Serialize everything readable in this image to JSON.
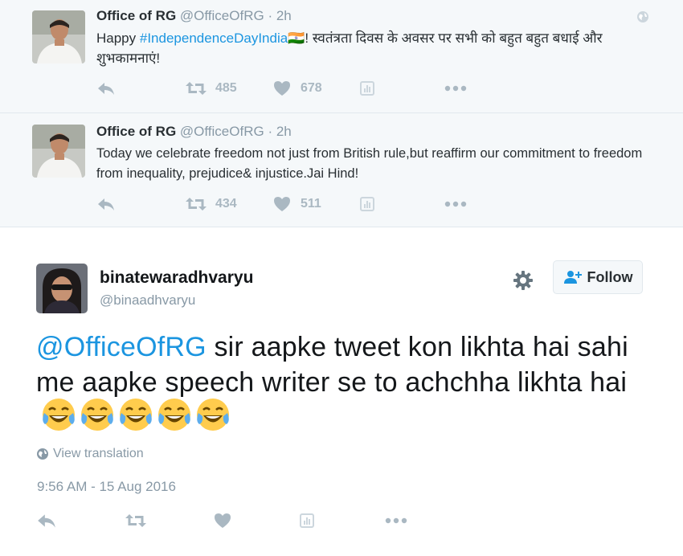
{
  "tweets": [
    {
      "name": "Office of RG",
      "handle": "@OfficeOfRG",
      "time": "· 2h",
      "text_prefix": "Happy ",
      "hashtag": "#IndependenceDayIndia",
      "flag_emoji": "🇮🇳",
      "text_suffix": "! स्वतंत्रता दिवस के अवसर पर सभी को बहुत बहुत बधाई और शुभकामनाएं!",
      "retweets": "485",
      "likes": "678"
    },
    {
      "name": "Office of RG",
      "handle": "@OfficeOfRG",
      "time": "· 2h",
      "text": "Today we celebrate freedom not just from British rule,but reaffirm our commitment to freedom from inequality, prejudice& injustice.Jai Hind!",
      "retweets": "434",
      "likes": "511"
    }
  ],
  "main_tweet": {
    "name": "binatewaradhvaryu",
    "handle": "@binaadhvaryu",
    "follow_label": "Follow",
    "mention": "@OfficeOfRG",
    "text": " sir aapke tweet kon likhta hai sahi me aapke speech writer se to achchha likhta hai",
    "emoji_count": 5,
    "view_translation": "View translation",
    "timestamp": "9:56 AM - 15 Aug 2016"
  },
  "icons": [
    "reply-icon",
    "retweet-icon",
    "heart-icon",
    "analytics-icon",
    "more-icon",
    "globe-icon",
    "gear-icon",
    "follow-person-icon",
    "laughing-crying-emoji"
  ],
  "colors": {
    "link": "#1b95e0",
    "muted": "#8899a6",
    "icon": "#aab8c2",
    "bg_quoted": "#f5f8fa"
  }
}
